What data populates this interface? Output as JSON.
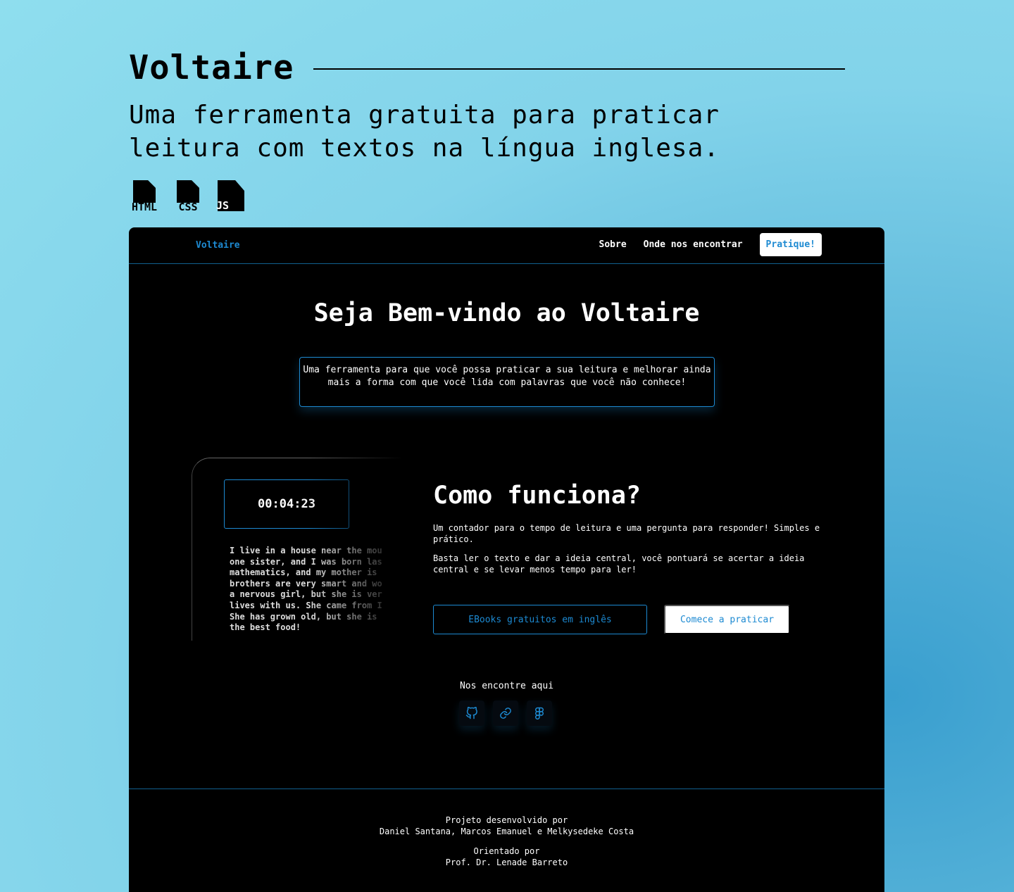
{
  "showcase": {
    "title": "Voltaire",
    "subtitle": "Uma ferramenta gratuita para praticar leitura com textos na língua inglesa.",
    "tech": [
      {
        "label": "HTML",
        "icon": "html-file-icon"
      },
      {
        "label": "CSS",
        "icon": "css-file-icon"
      },
      {
        "label": "JS",
        "icon": "js-file-icon"
      }
    ]
  },
  "nav": {
    "brand": "Voltaire",
    "links": [
      "Sobre",
      "Onde nos encontrar"
    ],
    "cta": "Pratique!"
  },
  "hero": {
    "title": "Seja Bem-vindo ao Voltaire",
    "description": "Uma ferramenta para que você possa praticar a sua leitura e melhorar ainda mais a forma com que você lida com palavras que você não conhece!"
  },
  "demo": {
    "timer": "00:04:23",
    "text": "I live in a house near the mou\none sister, and I was born las\nmathematics, and my mother is \nbrothers are very smart and wo\na nervous girl, but she is ver\nlives with us. She came from I\nShe has grown old, but she is \nthe best food!"
  },
  "how": {
    "title": "Como funciona?",
    "p1": "Um contador para o tempo de leitura e uma pergunta para responder! Simples e prático.",
    "p2": "Basta ler o texto e dar a ideia central, você pontuará se acertar a ideia central e se levar menos tempo para ler!",
    "btn_ebooks": "EBooks gratuitos em inglês",
    "btn_start": "Comece a praticar"
  },
  "social": {
    "label": "Nos encontre aqui",
    "icons": [
      "github-icon",
      "link-icon",
      "figma-icon"
    ]
  },
  "footer": {
    "line1": "Projeto desenvolvido por",
    "line2": "Daniel Santana, Marcos Emanuel e Melkysedeke Costa",
    "line3": "Orientado por",
    "line4": "Prof. Dr. Lenade Barreto"
  },
  "colors": {
    "accent": "#1d8ad2",
    "background": "#000000",
    "divider": "#11608f"
  }
}
